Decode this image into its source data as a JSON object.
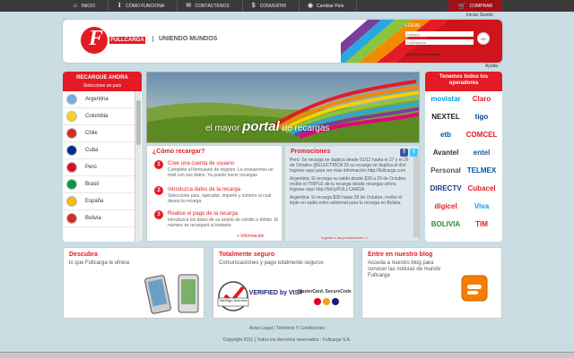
{
  "nav": {
    "items": [
      {
        "label": "INICIO",
        "icon": "home-icon",
        "glyph": "⌂"
      },
      {
        "label": "CÓMO FUNCIONA",
        "icon": "info-icon",
        "glyph": "ℹ"
      },
      {
        "label": "CONTÁCTENOS",
        "icon": "mail-icon",
        "glyph": "✉"
      },
      {
        "label": "CONVERTIR",
        "icon": "dollar-icon",
        "glyph": "$"
      },
      {
        "label": "Cambiar País",
        "icon": "globe-icon",
        "glyph": "◉"
      }
    ],
    "cart_label": "COMPRAR",
    "cart_glyph": "🛒",
    "login_link": "Iniciar Sesión"
  },
  "header": {
    "logo_letter": "F",
    "logo_text": "FULLCARGA",
    "tagline": "UNIENDO MUNDOS",
    "login": {
      "title": "LOGIN",
      "user_placeholder": "Usuario",
      "pass_placeholder": "Contraseña",
      "button": "OK",
      "forgot": "Olvidó Mi Contraseña"
    },
    "help": "Ayuda"
  },
  "left": {
    "title": "RECARGUE AHORA",
    "subtitle": "Seleccione un país",
    "countries": [
      {
        "name": "Argentina",
        "flag": "#74acdf"
      },
      {
        "name": "Colombia",
        "flag": "#fcd116"
      },
      {
        "name": "Chile",
        "flag": "#d52b1e"
      },
      {
        "name": "Cuba",
        "flag": "#002a8f"
      },
      {
        "name": "Perú",
        "flag": "#d91023"
      },
      {
        "name": "Brasil",
        "flag": "#009c3b"
      },
      {
        "name": "España",
        "flag": "#f1bf00"
      },
      {
        "name": "Bolivia",
        "flag": "#d52b1e"
      }
    ]
  },
  "banner": {
    "pre": "el mayor",
    "bold": "portal",
    "post": "de recargas"
  },
  "como": {
    "title": "¿Cómo recargar?",
    "steps": [
      {
        "num": "1",
        "title": "Cree una cuenta de usuario",
        "desc": "Complete el formulario de registro. Le enviaremos un mail con sus datos. Ya puede hacer recargas"
      },
      {
        "num": "2",
        "title": "Introduzca datos de la recarga",
        "desc": "Seleccione país, operador, importe y número al cual desea la recarga."
      },
      {
        "num": "3",
        "title": "Realice el pago de la recarga",
        "desc": "Introduzca los datos de su tarjeta de crédito o débito. El número se recargará al instante."
      }
    ],
    "more": "+ Información"
  },
  "promos": {
    "title": "Promociones",
    "items": [
      "Perú: Se recarga se duplica desde 01/12 hasta el 27 y el 26 de Octubre @ELECTRICA 33 su recarga se duplica el día! Ingrese aquí para ver más información http://fullcarga.com",
      "Argentina: Si recarga su saldo desde $30 a 29 de Octubre, recibe el TRIPLE de tu recarga desde recargas ahora Ingrese aquí http://bit.ly/FULLCARGA",
      "Argentina: Si recarga $30 hasta 29 de Octubre, recibe el triple en saldo extra adicional para tu recarga en Bolivia."
    ],
    "more": "Ingrese a las promociones >>",
    "fb": "f",
    "tw": "t"
  },
  "operators": {
    "title": "Tenemos todos los operadores",
    "items": [
      {
        "name": "movistar",
        "color": "#009ee0"
      },
      {
        "name": "Claro",
        "color": "#e41b24"
      },
      {
        "name": "NEXTEL",
        "color": "#222222"
      },
      {
        "name": "tigo",
        "color": "#00468c"
      },
      {
        "name": "etb",
        "color": "#0057a4"
      },
      {
        "name": "COMCEL",
        "color": "#e41b24"
      },
      {
        "name": "Avantel",
        "color": "#333333"
      },
      {
        "name": "entel",
        "color": "#1d4f9c"
      },
      {
        "name": "Personal",
        "color": "#555555"
      },
      {
        "name": "TELMEX",
        "color": "#0055a5"
      },
      {
        "name": "DIRECTV",
        "color": "#1b3c8f"
      },
      {
        "name": "Cubacel",
        "color": "#e41b24"
      },
      {
        "name": "digicel",
        "color": "#e41b24"
      },
      {
        "name": "Viva",
        "color": "#009ee0"
      },
      {
        "name": "BOLIVIA",
        "color": "#2e8b3a"
      },
      {
        "name": "TIM",
        "color": "#e41b24"
      }
    ]
  },
  "cards": {
    "descubra_title": "Descubra",
    "descubra_sub": "lo que Fullcarga le ofrece",
    "seguro_title": "Totalmente seguro",
    "seguro_sub": "Comunicaciones y pago totalmente seguros",
    "verisign": "VeriSign Secured",
    "visa": "VERIFIED by VISA",
    "mastercard": "MasterCard. SecureCode",
    "blog_title": "Entre en nuestro blog",
    "blog_sub": "Acceda a nuestro blog para conocer las noticias de mundo Fullcarga"
  },
  "footer": {
    "links": "Aviso Legal | Términos Y Condiciones",
    "copy": "Copyright 2011 | Todos los derechos reservados - Fullcarga S.A."
  }
}
